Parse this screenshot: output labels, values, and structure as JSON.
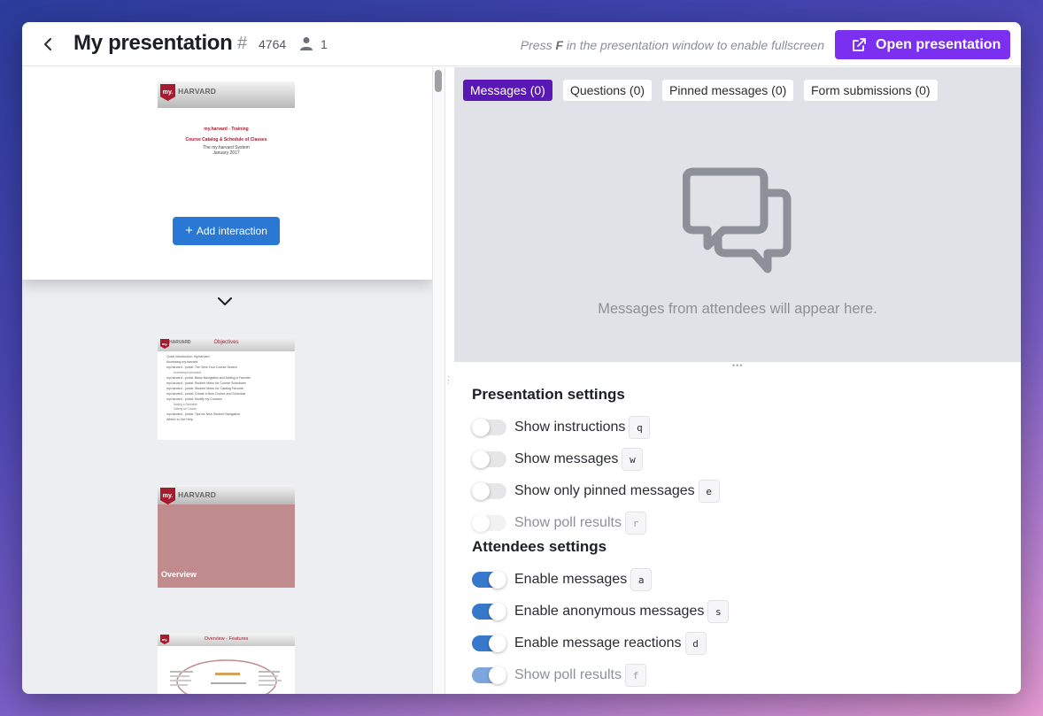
{
  "header": {
    "title": "My presentation",
    "code": "4764",
    "attendee_count": "1",
    "hint_prefix": "Press ",
    "hint_key": "F",
    "hint_suffix": " in the presentation window to enable fullscreen",
    "open_button": "Open presentation"
  },
  "slides": {
    "current": {
      "logo": "my.",
      "brand": "HARVARD",
      "line1": "my.harvard - Training",
      "line2": "Course Catalog & Schedule of Classes",
      "line3": "The my.harvard System",
      "line4": "January 2017"
    },
    "add_interaction": "Add interaction",
    "objectives": {
      "title": "Objectives",
      "bullets": [
        "Quick introduction: my.harvard",
        "Accessing my.harvard",
        "my.harvard - portal: The View Your Course Search",
        "my.harvard - portal: Basic Navigation and Adding a Favorite",
        "my.harvard - portal: Student Menu for Course Schedules",
        "my.harvard - portal: Student Menu for Catalog Favorite",
        "my.harvard - portal: Create a New Course and Schedule",
        "my.harvard - portal: Modify my Courses",
        "my.harvard - portal: Tips for New Student Navigation",
        "Where to Get Help"
      ],
      "subbullets": [
        "Accessing my.harvard",
        "Adding a Schedule",
        "Getting on Course"
      ]
    },
    "overview_label": "Overview",
    "features_title": "Overview - Features"
  },
  "tabs": [
    {
      "label": "Messages (0)"
    },
    {
      "label": "Questions (0)"
    },
    {
      "label": "Pinned messages (0)"
    },
    {
      "label": "Form submissions (0)"
    }
  ],
  "empty_message": "Messages from attendees will appear here.",
  "presentation_settings": {
    "heading": "Presentation settings",
    "items": [
      {
        "label": "Show instructions",
        "key": "q"
      },
      {
        "label": "Show messages",
        "key": "w"
      },
      {
        "label": "Show only pinned messages",
        "key": "e"
      },
      {
        "label": "Show poll results",
        "key": "r"
      }
    ]
  },
  "attendees_settings": {
    "heading": "Attendees settings",
    "items": [
      {
        "label": "Enable messages",
        "key": "a"
      },
      {
        "label": "Enable anonymous messages",
        "key": "s"
      },
      {
        "label": "Enable message reactions",
        "key": "d"
      },
      {
        "label": "Show poll results",
        "key": "f"
      }
    ]
  },
  "colors": {
    "primary": "#7b2ff0",
    "active_tab": "#5b17b5",
    "toggle_on": "#3678cc",
    "brand_red": "#a51c30"
  }
}
